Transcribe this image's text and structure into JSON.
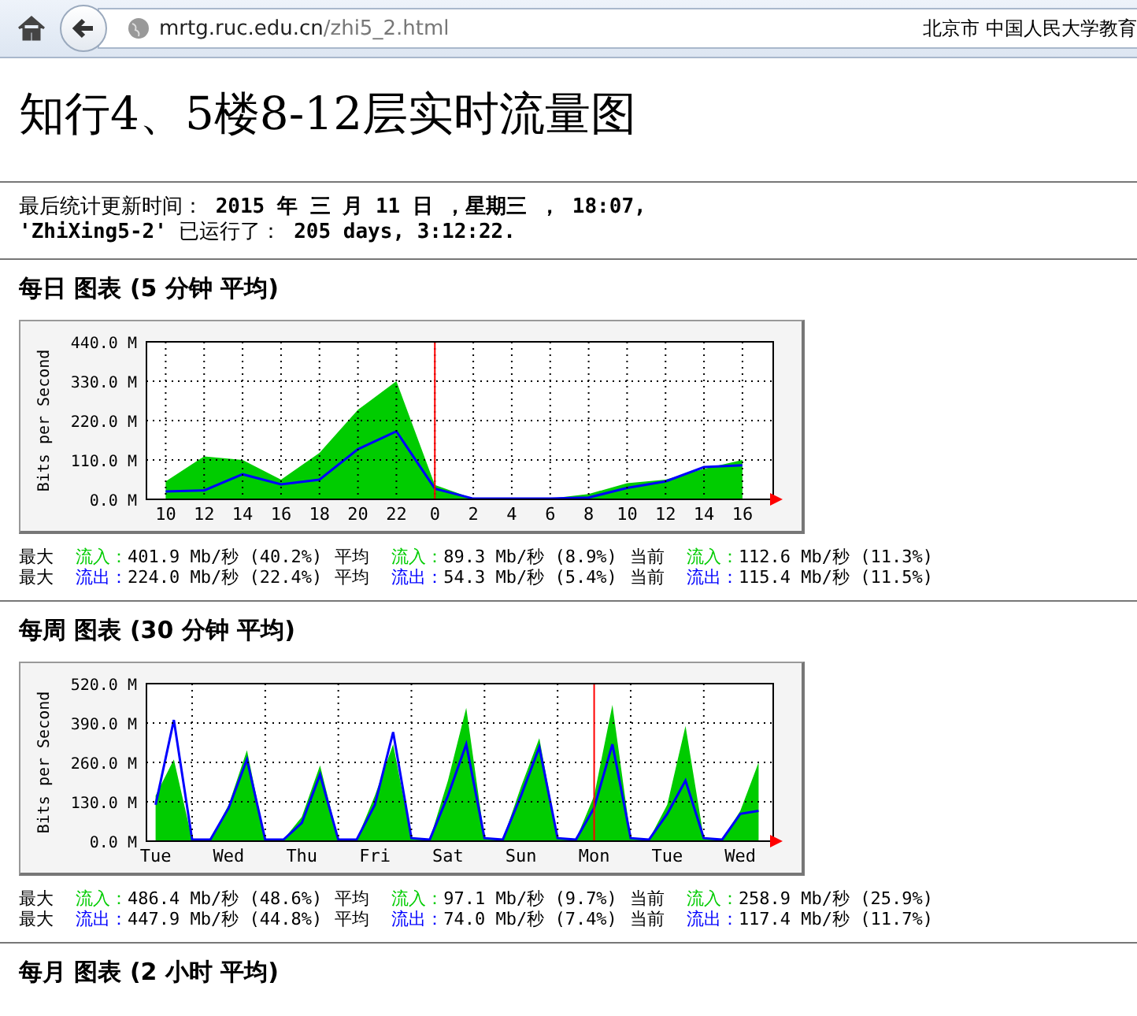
{
  "browser": {
    "url_host": "mrtg.ruc.edu.cn",
    "url_path": "/zhi5_2.html",
    "site_info": "北京市 中国人民大学教育"
  },
  "title": "知行4、5楼8-12层实时流量图",
  "status_lines": [
    "最后统计更新时间： **2015 年 三 月 11 日 ，星期三 ， 18:07,**",
    "**'ZhiXing5-2'** 已运行了： **205 days, 3:12:22.**"
  ],
  "sections": [
    {
      "heading": "每日 图表 (5 分钟 平均)",
      "chart_data": {
        "type": "area",
        "ylabel": "Bits per Second",
        "ylim": [
          0,
          440
        ],
        "categories": [
          "10",
          "12",
          "14",
          "16",
          "18",
          "20",
          "22",
          "0",
          "2",
          "4",
          "6",
          "8",
          "10",
          "12",
          "14",
          "16"
        ],
        "yticks": [
          {
            "value": 0,
            "label": "0.0 M"
          },
          {
            "value": 110,
            "label": "110.0 M"
          },
          {
            "value": 220,
            "label": "220.0 M"
          },
          {
            "value": 330,
            "label": "330.0 M"
          },
          {
            "value": 440,
            "label": "440.0 M"
          }
        ],
        "series": [
          {
            "type": "area",
            "color": "#00cc00",
            "values": [
              50,
              120,
              110,
              55,
              130,
              250,
              330,
              40,
              2,
              2,
              2,
              15,
              45,
              55,
              85,
              110
            ]
          },
          {
            "type": "line",
            "color": "#0000ff",
            "values": [
              22,
              25,
              70,
              42,
              55,
              140,
              190,
              30,
              2,
              2,
              2,
              5,
              32,
              50,
              90,
              95
            ]
          }
        ],
        "grid": true,
        "ref_lines": [
          {
            "axis": "x",
            "value": "0",
            "color": "#ff0000"
          }
        ]
      },
      "stats": [
        {
          "color": "#00cc00",
          "items": [
            {
              "heading": "最大",
              "label": "流入：",
              "value": "401.9 Mb/秒 (40.2%)"
            },
            {
              "heading": "平均",
              "label": "流入：",
              "value": "89.3 Mb/秒 (8.9%)"
            },
            {
              "heading": "当前",
              "label": "流入：",
              "value": "112.6 Mb/秒 (11.3%)"
            }
          ]
        },
        {
          "color": "#0000ff",
          "items": [
            {
              "heading": "最大",
              "label": "流出：",
              "value": "224.0 Mb/秒 (22.4%)"
            },
            {
              "heading": "平均",
              "label": "流出：",
              "value": "54.3 Mb/秒 (5.4%)"
            },
            {
              "heading": "当前",
              "label": "流出：",
              "value": "115.4 Mb/秒 (11.5%)"
            }
          ]
        }
      ]
    },
    {
      "heading": "每周 图表 (30 分钟 平均)",
      "chart_data": {
        "type": "area",
        "ylabel": "Bits per Second",
        "grid": true,
        "ylim": [
          0,
          520
        ],
        "categories": [
          "Tue",
          null,
          null,
          null,
          "Wed",
          null,
          null,
          null,
          "Thu",
          null,
          null,
          null,
          "Fri",
          null,
          null,
          null,
          "Sat",
          null,
          null,
          null,
          "Sun",
          null,
          null,
          null,
          "Mon",
          null,
          null,
          null,
          "Tue",
          null,
          null,
          null,
          "Wed",
          null
        ],
        "yticks": [
          {
            "value": 0,
            "label": "0.0 M"
          },
          {
            "value": 130,
            "label": "130.0 M"
          },
          {
            "value": 260,
            "label": "260.0 M"
          },
          {
            "value": 390,
            "label": "390.0 M"
          },
          {
            "value": 520,
            "label": "520.0 M"
          }
        ],
        "series": [
          {
            "type": "area",
            "color": "#00cc00",
            "values": [
              150,
              270,
              5,
              5,
              120,
              300,
              5,
              5,
              80,
              250,
              5,
              5,
              150,
              320,
              10,
              5,
              200,
              440,
              10,
              5,
              180,
              340,
              10,
              5,
              150,
              450,
              10,
              5,
              120,
              380,
              10,
              5,
              100,
              260
            ]
          },
          {
            "type": "line",
            "color": "#0000ff",
            "values": [
              120,
              400,
              5,
              5,
              110,
              270,
              5,
              5,
              60,
              220,
              5,
              5,
              120,
              360,
              10,
              5,
              150,
              320,
              10,
              5,
              150,
              310,
              10,
              5,
              110,
              320,
              10,
              5,
              90,
              200,
              10,
              5,
              90,
              100
            ]
          }
        ],
        "ref_lines": [
          {
            "axis": "x",
            "value": "Mon",
            "color": "#ff0000"
          }
        ]
      },
      "stats": [
        {
          "color": "#00cc00",
          "items": [
            {
              "heading": "最大",
              "label": "流入：",
              "value": "486.4 Mb/秒 (48.6%)"
            },
            {
              "heading": "平均",
              "label": "流入：",
              "value": "97.1 Mb/秒 (9.7%)"
            },
            {
              "heading": "当前",
              "label": "流入：",
              "value": "258.9 Mb/秒 (25.9%)"
            }
          ]
        },
        {
          "color": "#0000ff",
          "items": [
            {
              "heading": "最大",
              "label": "流出：",
              "value": "447.9 Mb/秒 (44.8%)"
            },
            {
              "heading": "平均",
              "label": "流出：",
              "value": "74.0 Mb/秒 (7.4%)"
            },
            {
              "heading": "当前",
              "label": "流出：",
              "value": "117.4 Mb/秒 (11.7%)"
            }
          ]
        }
      ]
    },
    {
      "heading": "每月 图表 (2 小时 平均)"
    }
  ]
}
